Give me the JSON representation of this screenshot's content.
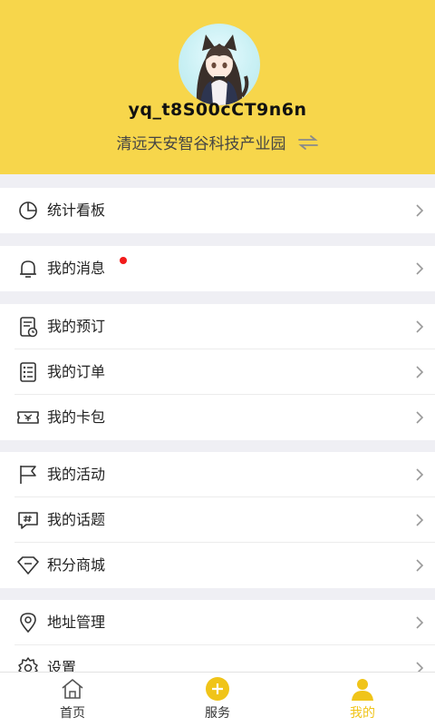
{
  "profile": {
    "username": "yq_t8S00cCT9n6n",
    "location": "清远天安智谷科技产业园"
  },
  "menu": {
    "stats": "统计看板",
    "messages": "我的消息",
    "reservations": "我的预订",
    "orders": "我的订单",
    "cards": "我的卡包",
    "activities": "我的活动",
    "topics": "我的话题",
    "points_mall": "积分商城",
    "address": "地址管理",
    "settings": "设置"
  },
  "tabbar": {
    "home": "首页",
    "service": "服务",
    "mine": "我的"
  },
  "colors": {
    "header_bg": "#f7d64b",
    "accent": "#f0c419",
    "notification_dot": "#f21b1b"
  }
}
